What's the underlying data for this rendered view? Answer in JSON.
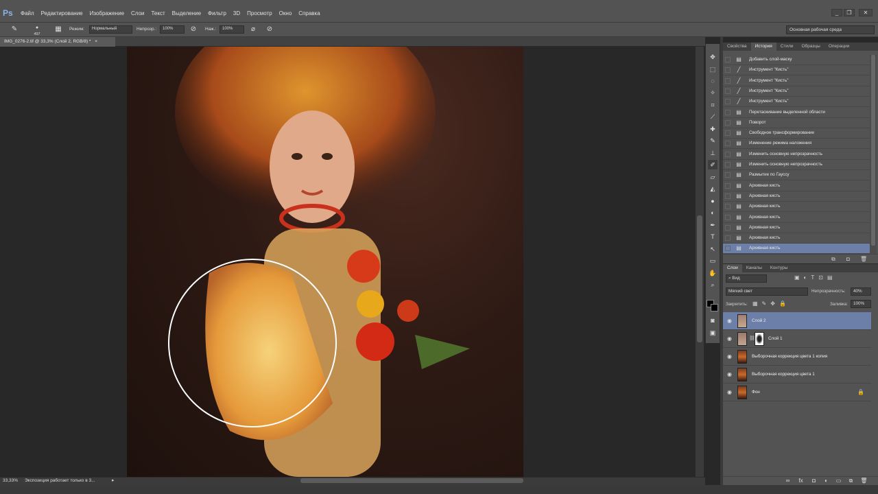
{
  "app": {
    "logo": "Ps"
  },
  "menu": [
    "Файл",
    "Редактирование",
    "Изображение",
    "Слои",
    "Текст",
    "Выделение",
    "Фильтр",
    "3D",
    "Просмотр",
    "Окно",
    "Справка"
  ],
  "window_controls": [
    "_",
    "❐",
    "✕"
  ],
  "options": {
    "brush_size": "497",
    "mode_label": "Режим:",
    "mode_value": "Нормальный",
    "opacity_label": "Непрозр.:",
    "opacity_value": "100%",
    "flow_label": "Наж.:",
    "flow_value": "100%",
    "workspace": "Основная рабочая среда"
  },
  "document": {
    "tab": "IMG_0276-2.tif @ 33,3% (Слой 2, RGB/8) *",
    "zoom": "33,33%",
    "status": "Экспозиция работает только в 3..."
  },
  "brush_cursor": {
    "shape": "circle",
    "color": "#ffffff"
  },
  "history": {
    "tabs": [
      "Свойства",
      "История",
      "Стили",
      "Образцы",
      "Операции"
    ],
    "active_tab": "История",
    "items": [
      {
        "label": "Добавить слой-маску",
        "icon": "doc-icon"
      },
      {
        "label": "Инструмент \"Кисть\"",
        "icon": "brush-icon"
      },
      {
        "label": "Инструмент \"Кисть\"",
        "icon": "brush-icon"
      },
      {
        "label": "Инструмент \"Кисть\"",
        "icon": "brush-icon"
      },
      {
        "label": "Инструмент \"Кисть\"",
        "icon": "brush-icon"
      },
      {
        "label": "Перетаскивание выделенной области",
        "icon": "doc-icon"
      },
      {
        "label": "Поворот",
        "icon": "doc-icon"
      },
      {
        "label": "Свободное трансформирование",
        "icon": "doc-icon"
      },
      {
        "label": "Изменение режима наложения",
        "icon": "doc-icon"
      },
      {
        "label": "Изменить основную непрозрачность",
        "icon": "doc-icon"
      },
      {
        "label": "Изменить основную непрозрачность",
        "icon": "doc-icon"
      },
      {
        "label": "Размытие по Гауссу",
        "icon": "doc-icon"
      },
      {
        "label": "Архивная кисть",
        "icon": "doc-icon"
      },
      {
        "label": "Архивная кисть",
        "icon": "doc-icon"
      },
      {
        "label": "Архивная кисть",
        "icon": "doc-icon"
      },
      {
        "label": "Архивная кисть",
        "icon": "doc-icon"
      },
      {
        "label": "Архивная кисть",
        "icon": "doc-icon"
      },
      {
        "label": "Архивная кисть",
        "icon": "doc-icon"
      },
      {
        "label": "Архивная кисть",
        "icon": "doc-icon"
      }
    ],
    "selected_index": 18
  },
  "layers": {
    "tabs": [
      "Слои",
      "Каналы",
      "Контуры"
    ],
    "active_tab": "Слои",
    "filter": "Вид",
    "blend_mode": "Мягкий свет",
    "opacity_label": "Непрозрачность:",
    "opacity_value": "40%",
    "lock_label": "Закрепить:",
    "fill_label": "Заливка:",
    "fill_value": "100%",
    "items": [
      {
        "name": "Слой 2",
        "selected": true
      },
      {
        "name": "Слой 1",
        "selected": false,
        "mask": true
      },
      {
        "name": "Выборочная коррекция цвета 1 копия",
        "selected": false
      },
      {
        "name": "Выборочная коррекция цвета 1",
        "selected": false
      },
      {
        "name": "Фон",
        "selected": false,
        "locked": true
      }
    ]
  },
  "colors": {
    "selection": "#6c7fa8",
    "panel": "#535353",
    "dark": "#282828"
  }
}
